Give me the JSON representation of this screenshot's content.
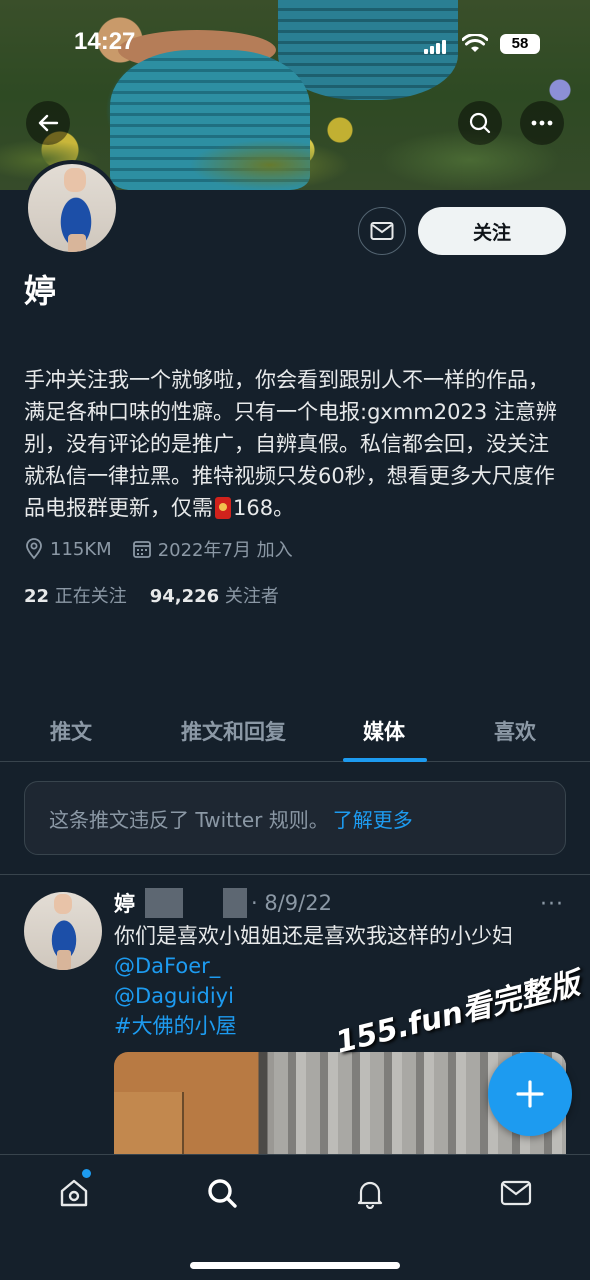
{
  "status_bar": {
    "time": "14:27",
    "battery": "58"
  },
  "profile": {
    "name": "婷",
    "follow_label": "关注",
    "bio": "手冲关注我一个就够啦，你会看到跟别人不一样的作品，满足各种口味的性癖。只有一个电报:gxmm2023 注意辨别，没有评论的是推广，自辨真假。私信都会回，没关注就私信一律拉黑。推特视频只发60秒，想看更多大尺度作品电报群更新，仅需",
    "bio_suffix": "168。",
    "location": "115KM",
    "joined": "2022年7月 加入",
    "following_count": "22",
    "following_label": "正在关注",
    "followers_count": "94,226",
    "followers_label": "关注者"
  },
  "tabs": [
    {
      "label": "推文"
    },
    {
      "label": "推文和回复"
    },
    {
      "label": "媒体"
    },
    {
      "label": "喜欢"
    }
  ],
  "active_tab": "媒体",
  "notice": {
    "text": "这条推文违反了 Twitter 规则。",
    "link": "了解更多"
  },
  "tweet": {
    "name": "婷",
    "date": "· 8/9/22",
    "text": "你们是喜欢小姐姐还是喜欢我这样的小少妇",
    "mentions": [
      "@DaFoer_",
      "@Daguidiyi"
    ],
    "hashtag": "#大佛的小屋",
    "more": "···"
  },
  "watermark": "155.fun看完整版",
  "colors": {
    "accent": "#1d9bf0",
    "background": "#15202b",
    "secondary_text": "#8b98a5"
  },
  "icons": {
    "back": "arrow-left-icon",
    "search": "search-icon",
    "more": "more-horizontal-icon",
    "mail": "mail-icon",
    "location": "location-pin-icon",
    "calendar": "calendar-icon",
    "compose": "plus-icon",
    "nav": [
      "home-icon",
      "search-icon",
      "bell-icon",
      "mail-icon"
    ]
  }
}
